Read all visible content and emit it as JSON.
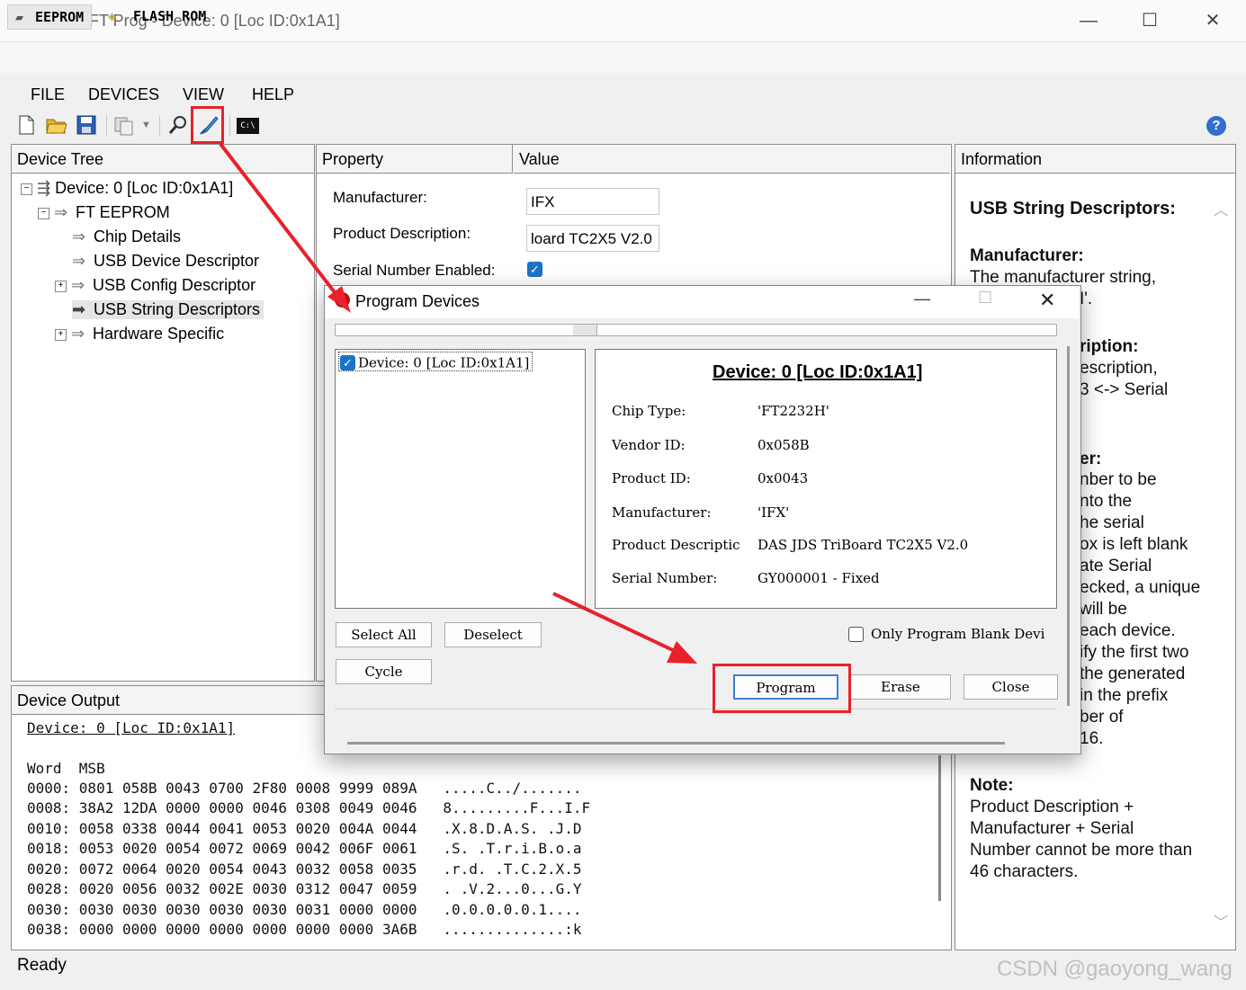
{
  "window": {
    "title": "FTDI - FT Prog - Device: 0 [Loc ID:0x1A1]",
    "minimize": "—",
    "maximize": "☐",
    "close": "✕"
  },
  "top_tabs": [
    "EEPROM",
    "FLASH ROM"
  ],
  "menu": [
    "FILE",
    "DEVICES",
    "VIEW",
    "HELP"
  ],
  "device_tree": {
    "header": "Device Tree",
    "items": [
      "Device: 0 [Loc ID:0x1A1]",
      "FT EEPROM",
      "Chip Details",
      "USB Device Descriptor",
      "USB Config Descriptor",
      "USB String Descriptors",
      "Hardware Specific"
    ]
  },
  "property_grid": {
    "property_header": "Property",
    "value_header": "Value",
    "rows": [
      {
        "label": "Manufacturer:",
        "value": "IFX"
      },
      {
        "label": "Product Description:",
        "value": "loard TC2X5 V2.0"
      },
      {
        "label": "Serial Number Enabled:",
        "value": ""
      }
    ]
  },
  "information": {
    "header": "Information",
    "title": "USB String Descriptors:",
    "manufacturer_heading": "Manufacturer:",
    "manufacturer_text": "The manufacturer string,",
    "manufacturer_frag": "I'.",
    "desc_heading_frag": "ription:",
    "desc_lines": [
      "escription,",
      "3 <-> Serial"
    ],
    "serial_heading_frag": "er:",
    "serial_lines": [
      "nber to be",
      "nto the",
      "he serial",
      "ox is left blank",
      "ate Serial",
      "ecked, a unique",
      "will be",
      "each device.",
      "ify the first two",
      "the generated",
      "in the prefix",
      "ber of",
      "16."
    ],
    "note_heading": "Note:",
    "note_lines": [
      "Product Description +",
      "Manufacturer + Serial",
      "Number cannot be more than",
      "46 characters."
    ]
  },
  "device_output": {
    "header": "Device Output",
    "device_line": "Device: 0 [Loc ID:0x1A1]",
    "columns": "Word  MSB",
    "rows": [
      "0000: 0801 058B 0043 0700 2F80 0008 9999 089A   .....C../.......",
      "0008: 38A2 12DA 0000 0000 0046 0308 0049 0046   8.........F...I.F",
      "0010: 0058 0338 0044 0041 0053 0020 004A 0044   .X.8.D.A.S. .J.D",
      "0018: 0053 0020 0054 0072 0069 0042 006F 0061   .S. .T.r.i.B.o.a",
      "0020: 0072 0064 0020 0054 0043 0032 0058 0035   .r.d. .T.C.2.X.5",
      "0028: 0020 0056 0032 002E 0030 0312 0047 0059   . .V.2...0...G.Y",
      "0030: 0030 0030 0030 0030 0030 0031 0000 0000   .0.0.0.0.0.1....",
      "0038: 0000 0000 0000 0000 0000 0000 0000 3A6B   ..............:k"
    ]
  },
  "status": "Ready",
  "watermark": "CSDN @gaoyong_wang",
  "dialog": {
    "title": "Program Devices",
    "device_item": "Device: 0 [Loc ID:0x1A1]",
    "details_title": "Device: 0 [Loc ID:0x1A1]",
    "details": [
      {
        "label": "Chip Type:",
        "value": "'FT2232H'"
      },
      {
        "label": "Vendor ID:",
        "value": "0x058B"
      },
      {
        "label": "Product ID:",
        "value": "0x0043"
      },
      {
        "label": "Manufacturer:",
        "value": "'IFX'"
      },
      {
        "label": "Product Descriptic",
        "value": "DAS JDS TriBoard TC2X5 V2.0"
      },
      {
        "label": "Serial Number:",
        "value": "GY000001 - Fixed"
      }
    ],
    "select_all": "Select All",
    "deselect": "Deselect",
    "cycle": "Cycle",
    "only_blank": "Only Program Blank Devi",
    "program": "Program",
    "erase": "Erase",
    "close": "Close"
  },
  "colors": {
    "annotation_red": "#e8212a",
    "check_blue": "#1a73c9"
  }
}
